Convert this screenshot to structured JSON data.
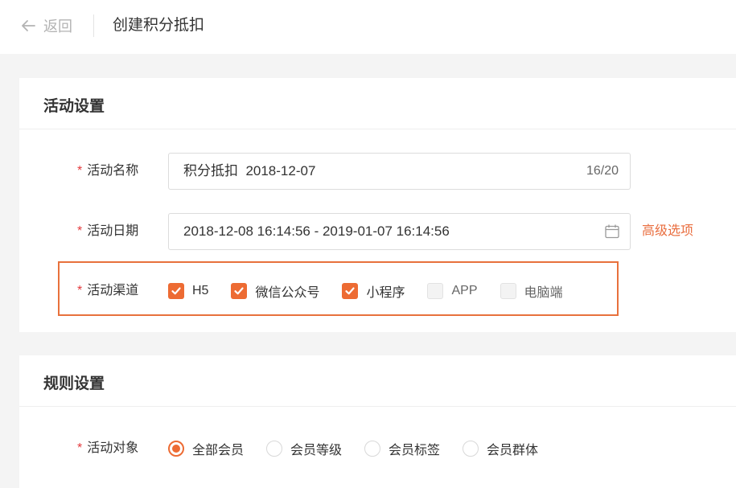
{
  "header": {
    "back_label": "返回",
    "title": "创建积分抵扣"
  },
  "activity_settings": {
    "title": "活动设置",
    "name": {
      "required_mark": "*",
      "label": "活动名称",
      "value": "积分抵扣  2018-12-07",
      "counter": "16/20"
    },
    "date": {
      "required_mark": "*",
      "label": "活动日期",
      "value": "2018-12-08 16:14:56 - 2019-01-07 16:14:56",
      "advanced_link": "高级选项"
    },
    "channels": {
      "required_mark": "*",
      "label": "活动渠道",
      "options": [
        {
          "label": "H5",
          "checked": true
        },
        {
          "label": "微信公众号",
          "checked": true
        },
        {
          "label": "小程序",
          "checked": true
        },
        {
          "label": "APP",
          "checked": false
        },
        {
          "label": "电脑端",
          "checked": false
        }
      ]
    }
  },
  "rule_settings": {
    "title": "规则设置",
    "target": {
      "required_mark": "*",
      "label": "活动对象",
      "options": [
        {
          "label": "全部会员",
          "selected": true
        },
        {
          "label": "会员等级",
          "selected": false
        },
        {
          "label": "会员标签",
          "selected": false
        },
        {
          "label": "会员群体",
          "selected": false
        }
      ]
    }
  },
  "colors": {
    "accent": "#ed6b33",
    "highlight_border": "#e8713c",
    "required": "#e4393c",
    "link": "#e96d3e"
  }
}
